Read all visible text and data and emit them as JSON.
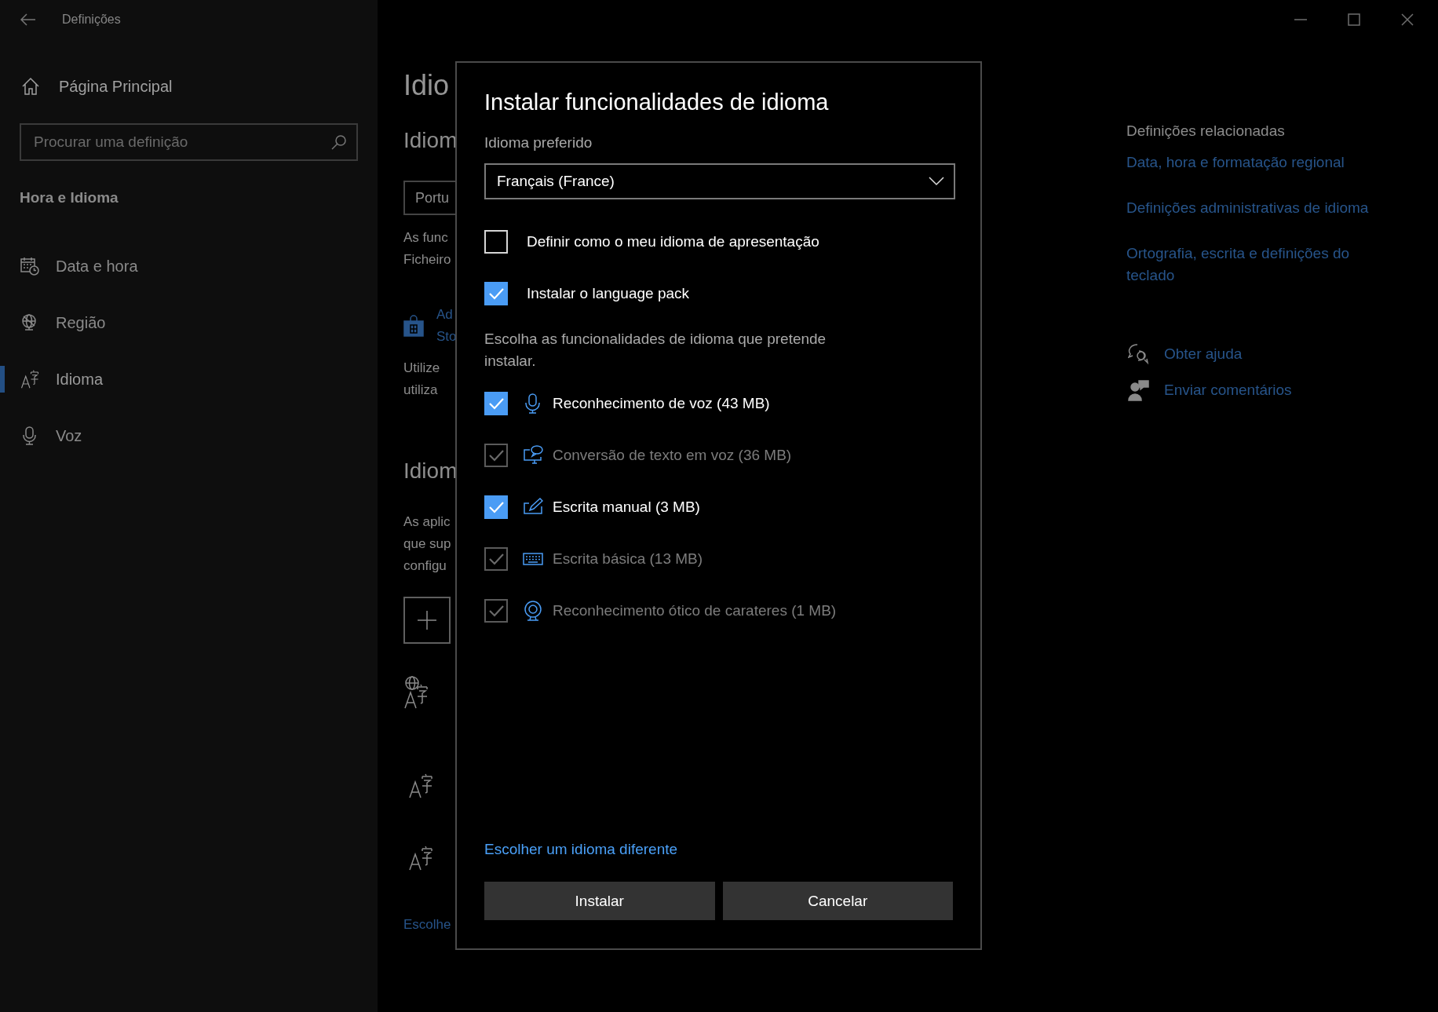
{
  "window": {
    "title": "Definições"
  },
  "sidebar": {
    "home": "Página Principal",
    "search": {
      "placeholder": "Procurar uma definição"
    },
    "section": "Hora e Idioma",
    "items": [
      {
        "label": "Data e hora",
        "selected": false
      },
      {
        "label": "Região",
        "selected": false
      },
      {
        "label": "Idioma",
        "selected": true
      },
      {
        "label": "Voz",
        "selected": false
      }
    ]
  },
  "background_page": {
    "items": [
      {
        "kind": "title",
        "text": "Idio"
      },
      {
        "kind": "subtitle",
        "text": "Idiom"
      },
      {
        "kind": "field",
        "text": "Portu"
      },
      {
        "kind": "paragraph",
        "lines": [
          "As func",
          "Ficheiro"
        ]
      },
      {
        "kind": "store-link",
        "lines": [
          "Ad",
          "Sto"
        ]
      },
      {
        "kind": "paragraph",
        "lines": [
          "Utilize",
          "utiliza"
        ]
      },
      {
        "kind": "subtitle",
        "text": "Idiom"
      },
      {
        "kind": "paragraph",
        "lines": [
          "As aplic",
          "que sup",
          "configu"
        ]
      },
      {
        "kind": "add-button"
      },
      {
        "kind": "globe-language-icon"
      },
      {
        "kind": "language-icon"
      },
      {
        "kind": "language-icon"
      },
      {
        "kind": "link",
        "text": "Escolhe"
      }
    ]
  },
  "related": {
    "heading": "Definições relacionadas",
    "links": [
      "Data, hora e formatação regional",
      "Definições administrativas de idioma",
      "Ortografia, escrita e definições do teclado"
    ]
  },
  "help": [
    {
      "label": "Obter ajuda"
    },
    {
      "label": "Enviar comentários"
    }
  ],
  "dialog": {
    "title": "Instalar funcionalidades de idioma",
    "preferred_label": "Idioma preferido",
    "language_dropdown": {
      "value": "Français (France)"
    },
    "options": [
      {
        "label": "Definir como o meu idioma de apresentação",
        "checked": false
      },
      {
        "label": "Instalar o language pack",
        "checked": true
      }
    ],
    "features_prompt": "Escolha as funcionalidades de idioma que pretende instalar.",
    "features": [
      {
        "label": "Reconhecimento de voz (43 MB)",
        "checked": true,
        "disabled": false
      },
      {
        "label": "Conversão de texto em voz (36 MB)",
        "checked": true,
        "disabled": true
      },
      {
        "label": "Escrita manual (3 MB)",
        "checked": true,
        "disabled": false
      },
      {
        "label": "Escrita básica (13 MB)",
        "checked": true,
        "disabled": true
      },
      {
        "label": "Reconhecimento ótico de carateres (1 MB)",
        "checked": true,
        "disabled": true
      }
    ],
    "other_language_link": "Escolher um idioma diferente",
    "buttons": [
      "Instalar",
      "Cancelar"
    ]
  }
}
